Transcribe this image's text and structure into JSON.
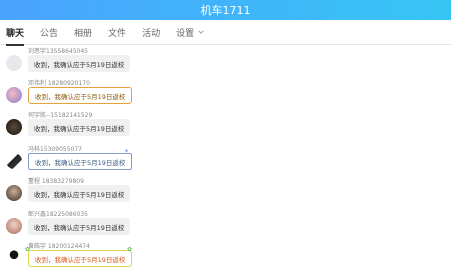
{
  "header": {
    "title": "机车1711"
  },
  "tabs": [
    {
      "label": "聊天",
      "active": true
    },
    {
      "label": "公告"
    },
    {
      "label": "相册"
    },
    {
      "label": "文件"
    },
    {
      "label": "活动"
    },
    {
      "label": "设置"
    }
  ],
  "messages": [
    {
      "name": "刘思宇13558645045",
      "text": "收到，我确认应于5月19日返校",
      "avatar": "avatar-1",
      "style": "plain"
    },
    {
      "name": "邓伟利 18280920170",
      "text": "收到，我确认应于5月19日返校",
      "avatar": "avatar-2",
      "style": "orange"
    },
    {
      "name": "何宇航--15182141529",
      "text": "收到，我确认应于5月19日返校",
      "avatar": "avatar-3",
      "style": "plain"
    },
    {
      "name": "冯科15309055077",
      "text": "收到，我确认应于5月19日返校",
      "avatar": "avatar-4",
      "style": "blue"
    },
    {
      "name": "董程 18383279809",
      "text": "收到，我确认应于5月19日返校",
      "avatar": "avatar-5",
      "style": "plain"
    },
    {
      "name": "郎兴鑫18225086035",
      "text": "收到，我确认应于5月19日返校",
      "avatar": "avatar-6",
      "style": "plain"
    },
    {
      "name": "黄皓宇 18200124474",
      "text": "收到，我确认应于5月19日返校",
      "avatar": "avatar-7",
      "style": "yellow"
    }
  ],
  "colors": {
    "header_start": "#4aa3ff",
    "header_end": "#36c6f4",
    "orange": "#e6a23c",
    "blue": "#7fa0c8",
    "yellow": "#e4d24a"
  }
}
